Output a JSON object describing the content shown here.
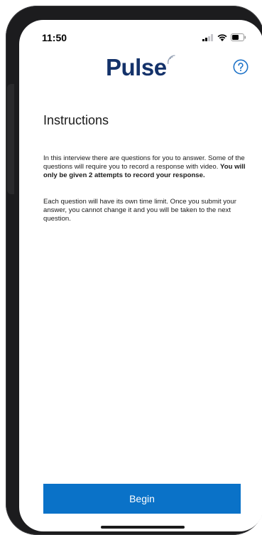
{
  "status_bar": {
    "time": "11:50",
    "icons": [
      "cellular-signal-icon",
      "wifi-icon",
      "battery-icon"
    ]
  },
  "header": {
    "logo_text": "Pulse",
    "logo_icon": "signal-waves-icon",
    "help_icon": "question-circle-icon"
  },
  "instructions": {
    "title": "Instructions",
    "paragraph1_text": "In this interview there are questions for you to answer. Some of the questions will require you to record a response with video. ",
    "paragraph1_bold": "You will only be given 2 attempts to record your response.",
    "paragraph2": "Each question will have its own time limit. Once you submit your answer, you cannot change it and you will be taken to the next question."
  },
  "actions": {
    "begin_label": "Begin"
  },
  "colors": {
    "brand_navy": "#14326a",
    "accent_blue": "#0a72c8",
    "help_icon": "#1e73c8"
  }
}
